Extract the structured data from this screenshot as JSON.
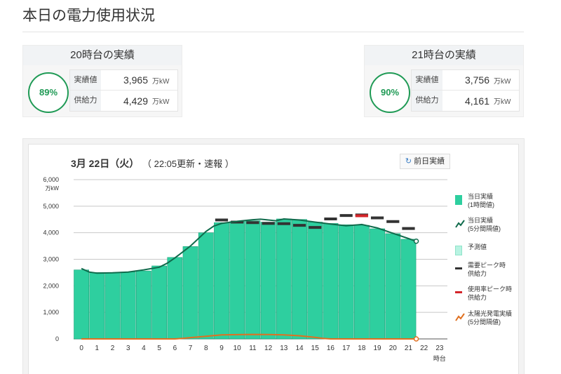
{
  "page_title": "本日の電力使用状況",
  "kpi_left": {
    "heading": "20時台の実績",
    "percent": "89%",
    "actual_label": "実績値",
    "actual_value": "3,965",
    "supply_label": "供給力",
    "supply_value": "4,429",
    "unit": "万kW"
  },
  "kpi_right": {
    "heading": "21時台の実績",
    "percent": "90%",
    "actual_label": "実績値",
    "actual_value": "3,756",
    "supply_label": "供給力",
    "supply_value": "4,161",
    "unit": "万kW"
  },
  "chart_header": {
    "date": "3月 22日（火）",
    "update": "（ 22:05更新・速報 ）",
    "prev_button": "前日実績"
  },
  "colors": {
    "bar": "#2ecf9f",
    "bar_edge": "#1fa57c",
    "line": "#106b4c",
    "solar": "#e07020",
    "peak_supply": "#333333",
    "usage_peak_supply": "#d4252a",
    "forecast": "#b8f3e2",
    "kpi_accent": "#1f9a55"
  },
  "legend": [
    {
      "key": "actual_hour",
      "label": "当日実績\n(1時間値)"
    },
    {
      "key": "actual_5min",
      "label": "当日実績\n(5分間隔値)"
    },
    {
      "key": "forecast",
      "label": "予測値"
    },
    {
      "key": "peak_supply",
      "label": "需要ピーク時\n供給力"
    },
    {
      "key": "usage_peak_supply",
      "label": "使用率ピーク時\n供給力"
    },
    {
      "key": "solar",
      "label": "太陽光発電実績\n(5分間隔値)"
    }
  ],
  "chart_data": {
    "type": "bar",
    "unit": "万kW",
    "xlabel": "時台",
    "ylim": [
      0,
      6000
    ],
    "yticks": [
      "0",
      "1,000",
      "2,000",
      "3,000",
      "4,000",
      "5,000",
      "6,000"
    ],
    "categories": [
      "0",
      "1",
      "2",
      "3",
      "4",
      "5",
      "6",
      "7",
      "8",
      "9",
      "10",
      "11",
      "12",
      "13",
      "14",
      "15",
      "16",
      "17",
      "18",
      "19",
      "20",
      "21",
      "22",
      "23"
    ],
    "series": [
      {
        "name": "当日実績(1時間値)",
        "type": "bar",
        "values": [
          2600,
          2500,
          2500,
          2520,
          2560,
          2750,
          3070,
          3480,
          4000,
          4380,
          4420,
          4450,
          4400,
          4520,
          4500,
          4400,
          4350,
          4300,
          4280,
          4150,
          3965,
          3756
        ]
      },
      {
        "name": "当日実績(5分間隔値)",
        "type": "line",
        "x": [
          0,
          0.5,
          1,
          2,
          3,
          4,
          5,
          5.5,
          6,
          7,
          8,
          8.5,
          9,
          10,
          11,
          11.5,
          12,
          12.5,
          13,
          14,
          15,
          16,
          17,
          18,
          19,
          20,
          21,
          21.5
        ],
        "y": [
          2650,
          2520,
          2480,
          2490,
          2520,
          2600,
          2700,
          2850,
          3050,
          3500,
          4050,
          4250,
          4350,
          4430,
          4490,
          4510,
          4480,
          4450,
          4520,
          4480,
          4400,
          4330,
          4260,
          4310,
          4180,
          3980,
          3780,
          3680
        ]
      },
      {
        "name": "需要ピーク時供給力",
        "type": "step",
        "values": [
          null,
          null,
          null,
          null,
          null,
          null,
          null,
          null,
          null,
          4480,
          4400,
          4380,
          4350,
          4340,
          4280,
          4200,
          4520,
          4650,
          4670,
          4560,
          4420,
          4161
        ]
      },
      {
        "name": "使用率ピーク時供給力",
        "type": "step",
        "values": [
          null,
          null,
          null,
          null,
          null,
          null,
          null,
          null,
          null,
          null,
          null,
          null,
          null,
          null,
          null,
          null,
          null,
          null,
          4640,
          null,
          null,
          null
        ]
      },
      {
        "name": "太陽光発電実績(5分間隔値)",
        "type": "line",
        "x": [
          0,
          6,
          6.5,
          7,
          8,
          9,
          10,
          11,
          12,
          13,
          14,
          15,
          15.5,
          16,
          21.5
        ],
        "y": [
          0,
          0,
          20,
          50,
          100,
          150,
          160,
          170,
          165,
          150,
          120,
          60,
          20,
          0,
          0
        ]
      }
    ]
  }
}
